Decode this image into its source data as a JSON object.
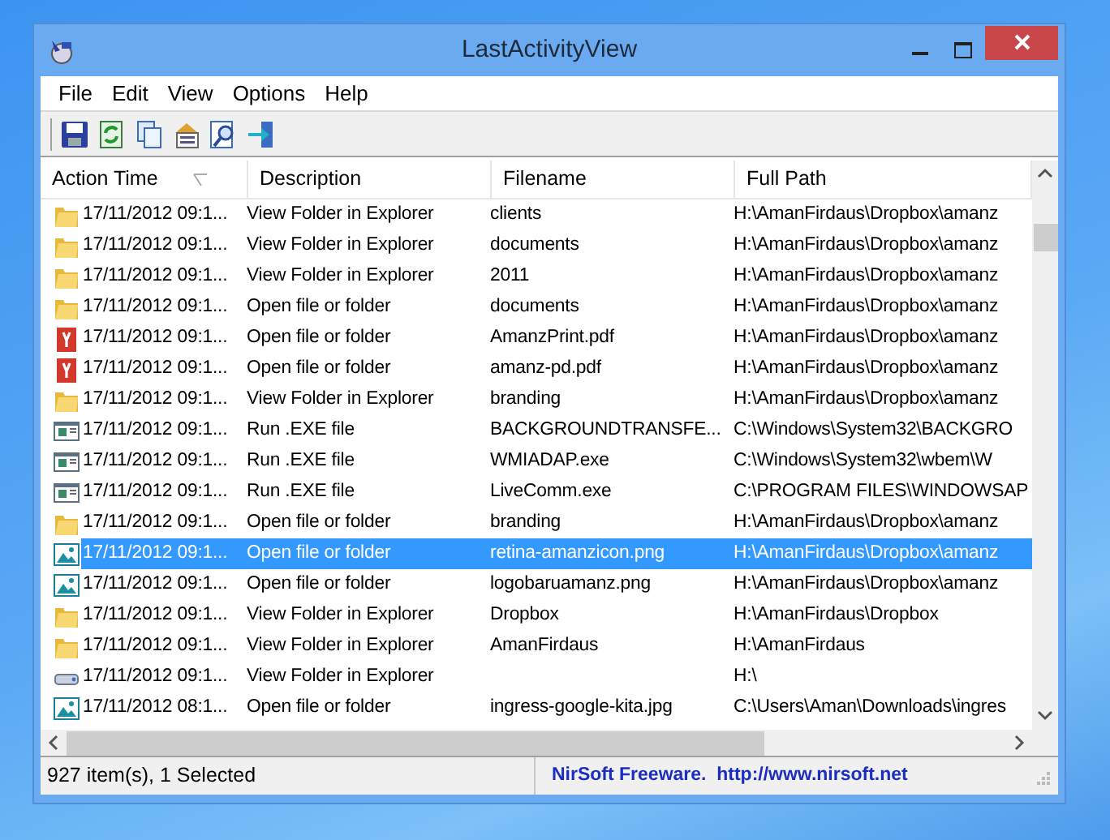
{
  "window": {
    "title": "LastActivityView"
  },
  "menu": [
    "File",
    "Edit",
    "View",
    "Options",
    "Help"
  ],
  "toolbar": [
    {
      "kind": "save"
    },
    {
      "kind": "refresh"
    },
    {
      "kind": "copy"
    },
    {
      "kind": "properties"
    },
    {
      "kind": "find"
    },
    {
      "kind": "exit"
    }
  ],
  "table": {
    "columns": [
      "Action Time",
      "Description",
      "Filename",
      "Full Path"
    ],
    "rows": [
      {
        "kind": "folder",
        "selected": false,
        "cells": [
          "17/11/2012 09:1...",
          "View Folder in Explorer",
          "clients",
          "H:\\AmanFirdaus\\Dropbox\\amanz"
        ]
      },
      {
        "kind": "folder",
        "selected": false,
        "cells": [
          "17/11/2012 09:1...",
          "View Folder in Explorer",
          "documents",
          "H:\\AmanFirdaus\\Dropbox\\amanz"
        ]
      },
      {
        "kind": "folder",
        "selected": false,
        "cells": [
          "17/11/2012 09:1...",
          "View Folder in Explorer",
          "2011",
          "H:\\AmanFirdaus\\Dropbox\\amanz"
        ]
      },
      {
        "kind": "folder",
        "selected": false,
        "cells": [
          "17/11/2012 09:1...",
          "Open file or folder",
          "documents",
          "H:\\AmanFirdaus\\Dropbox\\amanz"
        ]
      },
      {
        "kind": "pdf",
        "selected": false,
        "cells": [
          "17/11/2012 09:1...",
          "Open file or folder",
          "AmanzPrint.pdf",
          "H:\\AmanFirdaus\\Dropbox\\amanz"
        ]
      },
      {
        "kind": "pdf",
        "selected": false,
        "cells": [
          "17/11/2012 09:1...",
          "Open file or folder",
          "amanz-pd.pdf",
          "H:\\AmanFirdaus\\Dropbox\\amanz"
        ]
      },
      {
        "kind": "folder",
        "selected": false,
        "cells": [
          "17/11/2012 09:1...",
          "View Folder in Explorer",
          "branding",
          "H:\\AmanFirdaus\\Dropbox\\amanz"
        ]
      },
      {
        "kind": "exe",
        "selected": false,
        "cells": [
          "17/11/2012 09:1...",
          "Run .EXE file",
          "BACKGROUNDTRANSFE...",
          "C:\\Windows\\System32\\BACKGRO"
        ]
      },
      {
        "kind": "exe",
        "selected": false,
        "cells": [
          "17/11/2012 09:1...",
          "Run .EXE file",
          "WMIADAP.exe",
          "C:\\Windows\\System32\\wbem\\W"
        ]
      },
      {
        "kind": "exe",
        "selected": false,
        "cells": [
          "17/11/2012 09:1...",
          "Run .EXE file",
          "LiveComm.exe",
          "C:\\PROGRAM FILES\\WINDOWSAP"
        ]
      },
      {
        "kind": "folder",
        "selected": false,
        "cells": [
          "17/11/2012 09:1...",
          "Open file or folder",
          "branding",
          "H:\\AmanFirdaus\\Dropbox\\amanz"
        ]
      },
      {
        "kind": "image",
        "selected": true,
        "cells": [
          "17/11/2012 09:1...",
          "Open file or folder",
          "retina-amanzicon.png",
          "H:\\AmanFirdaus\\Dropbox\\amanz"
        ]
      },
      {
        "kind": "image",
        "selected": false,
        "cells": [
          "17/11/2012 09:1...",
          "Open file or folder",
          "logobaruamanz.png",
          "H:\\AmanFirdaus\\Dropbox\\amanz"
        ]
      },
      {
        "kind": "folder",
        "selected": false,
        "cells": [
          "17/11/2012 09:1...",
          "View Folder in Explorer",
          "Dropbox",
          "H:\\AmanFirdaus\\Dropbox"
        ]
      },
      {
        "kind": "folder",
        "selected": false,
        "cells": [
          "17/11/2012 09:1...",
          "View Folder in Explorer",
          "AmanFirdaus",
          "H:\\AmanFirdaus"
        ]
      },
      {
        "kind": "drive",
        "selected": false,
        "cells": [
          "17/11/2012 09:1...",
          "View Folder in Explorer",
          "",
          "H:\\"
        ]
      },
      {
        "kind": "image",
        "selected": false,
        "cells": [
          "17/11/2012 08:1...",
          "Open file or folder",
          "ingress-google-kita.jpg",
          "C:\\Users\\Aman\\Downloads\\ingres"
        ]
      }
    ]
  },
  "status_bar": {
    "count": "927 item(s), 1 Selected",
    "credit": "NirSoft Freeware.  http://www.nirsoft.net"
  }
}
